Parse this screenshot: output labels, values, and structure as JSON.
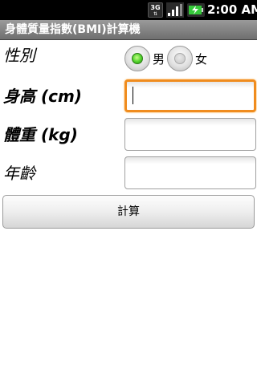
{
  "status_bar": {
    "network_label": "3G",
    "network_arrows": "⇅",
    "signal_icon": "signal-strength-icon",
    "battery_icon": "battery-charging-icon",
    "time": "2:00 AM"
  },
  "title_bar": {
    "title": "身體質量指數(BMI)計算機"
  },
  "form": {
    "gender_label": "性別",
    "gender_options": [
      {
        "label": "男",
        "selected": true
      },
      {
        "label": "女",
        "selected": false
      }
    ],
    "height_label": "身高 (cm)",
    "height_value": "",
    "weight_label": "體重 (kg)",
    "weight_value": "",
    "age_label": "年齡",
    "age_value": ""
  },
  "calculate_button": {
    "label": "計算"
  },
  "colors": {
    "focus_border": "#f08c1e",
    "radio_selected": "#4fd12a",
    "title_bar": "#808080",
    "status_bar": "#000000"
  }
}
